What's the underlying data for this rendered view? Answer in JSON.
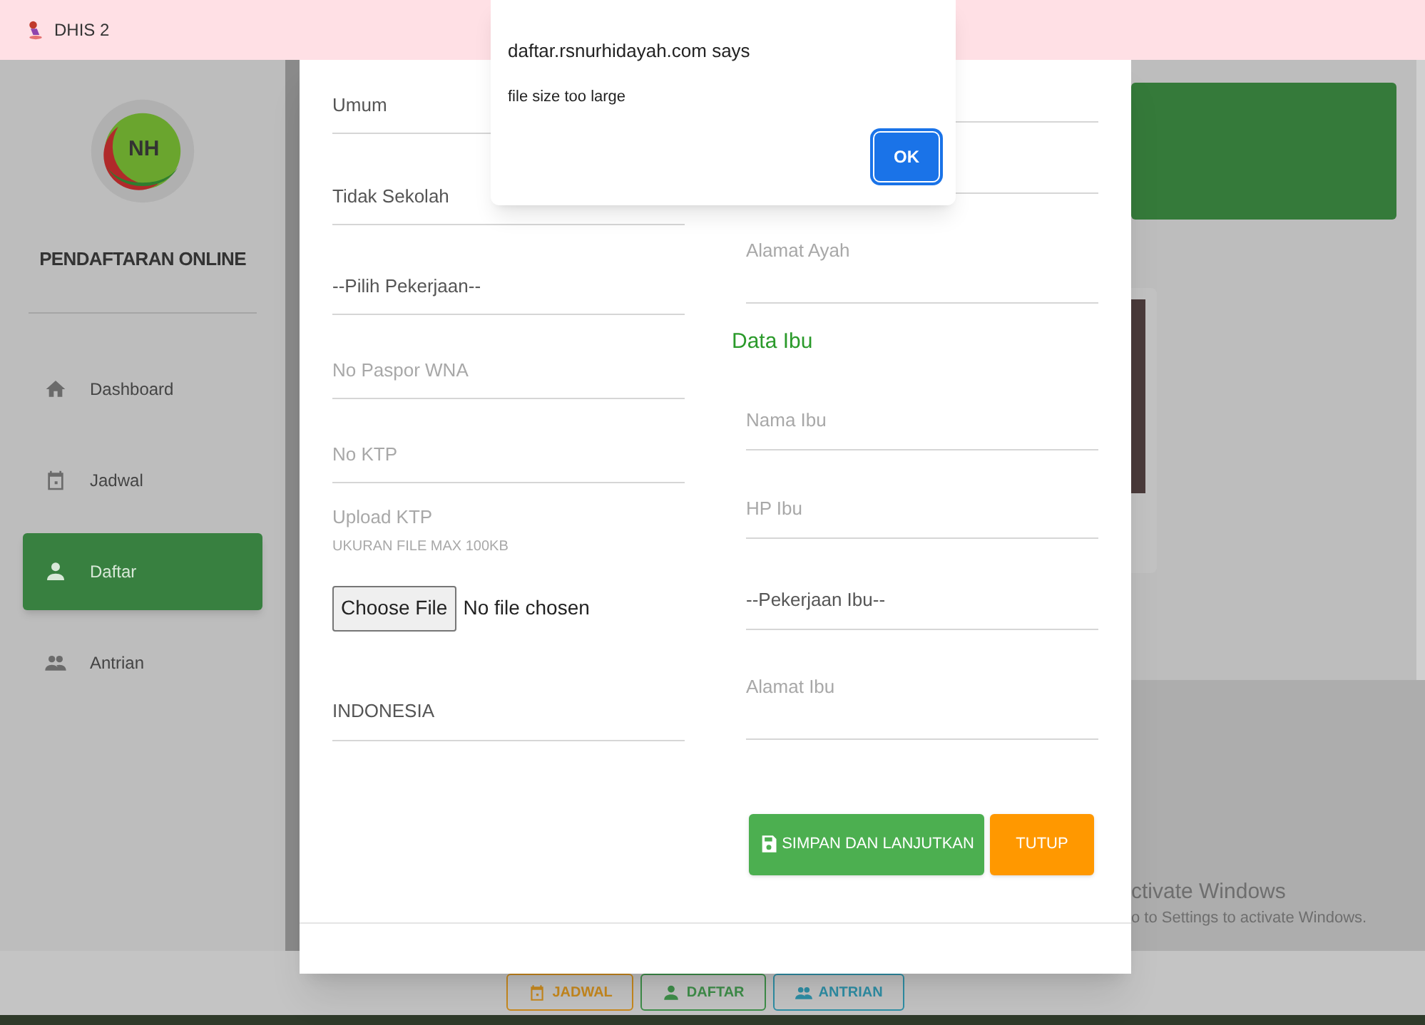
{
  "browser_tab": {
    "title": "DHIS 2"
  },
  "sidebar": {
    "logo_text": "NH",
    "title": "PENDAFTARAN ONLINE",
    "items": [
      {
        "label": "Dashboard",
        "selected": false
      },
      {
        "label": "Jadwal",
        "selected": false
      },
      {
        "label": "Daftar",
        "selected": true
      },
      {
        "label": "Antrian",
        "selected": false
      }
    ]
  },
  "form": {
    "left_fields": [
      {
        "kind": "select",
        "value": "Umum"
      },
      {
        "kind": "select",
        "value": "Tidak Sekolah"
      },
      {
        "kind": "select",
        "value": "--Pilih Pekerjaan--"
      },
      {
        "kind": "input",
        "placeholder": "No Paspor WNA"
      },
      {
        "kind": "input",
        "placeholder": "No KTP"
      },
      {
        "kind": "upload",
        "label": "Upload KTP",
        "hint": "UKURAN FILE MAX 100KB",
        "button": "Choose File",
        "status": "No file chosen"
      },
      {
        "kind": "input",
        "value": "INDONESIA"
      }
    ],
    "right_fields": [
      {
        "kind": "blank"
      },
      {
        "kind": "blank"
      },
      {
        "kind": "textarea",
        "placeholder": "Alamat Ayah"
      },
      {
        "kind": "heading",
        "text": "Data Ibu"
      },
      {
        "kind": "input",
        "placeholder": "Nama Ibu"
      },
      {
        "kind": "input",
        "placeholder": "HP Ibu"
      },
      {
        "kind": "select",
        "value": "--Pekerjaan Ibu--"
      },
      {
        "kind": "textarea",
        "placeholder": "Alamat Ibu"
      }
    ],
    "buttons": [
      {
        "kind": "save",
        "label": "SIMPAN DAN LANJUTKAN"
      },
      {
        "kind": "close",
        "label": "TUTUP"
      }
    ]
  },
  "bottom_nav": [
    {
      "label": "JADWAL",
      "color": "#c98a1e"
    },
    {
      "label": "DAFTAR",
      "color": "#3f8f4a"
    },
    {
      "label": "ANTRIAN",
      "color": "#2f8fa6"
    }
  ],
  "dialog": {
    "origin": "daftar.rsnurhidayah.com says",
    "message": "file size too large",
    "button": "OK"
  },
  "os_notice": {
    "title": "ctivate Windows",
    "subtitle": "o to Settings to activate Windows."
  }
}
